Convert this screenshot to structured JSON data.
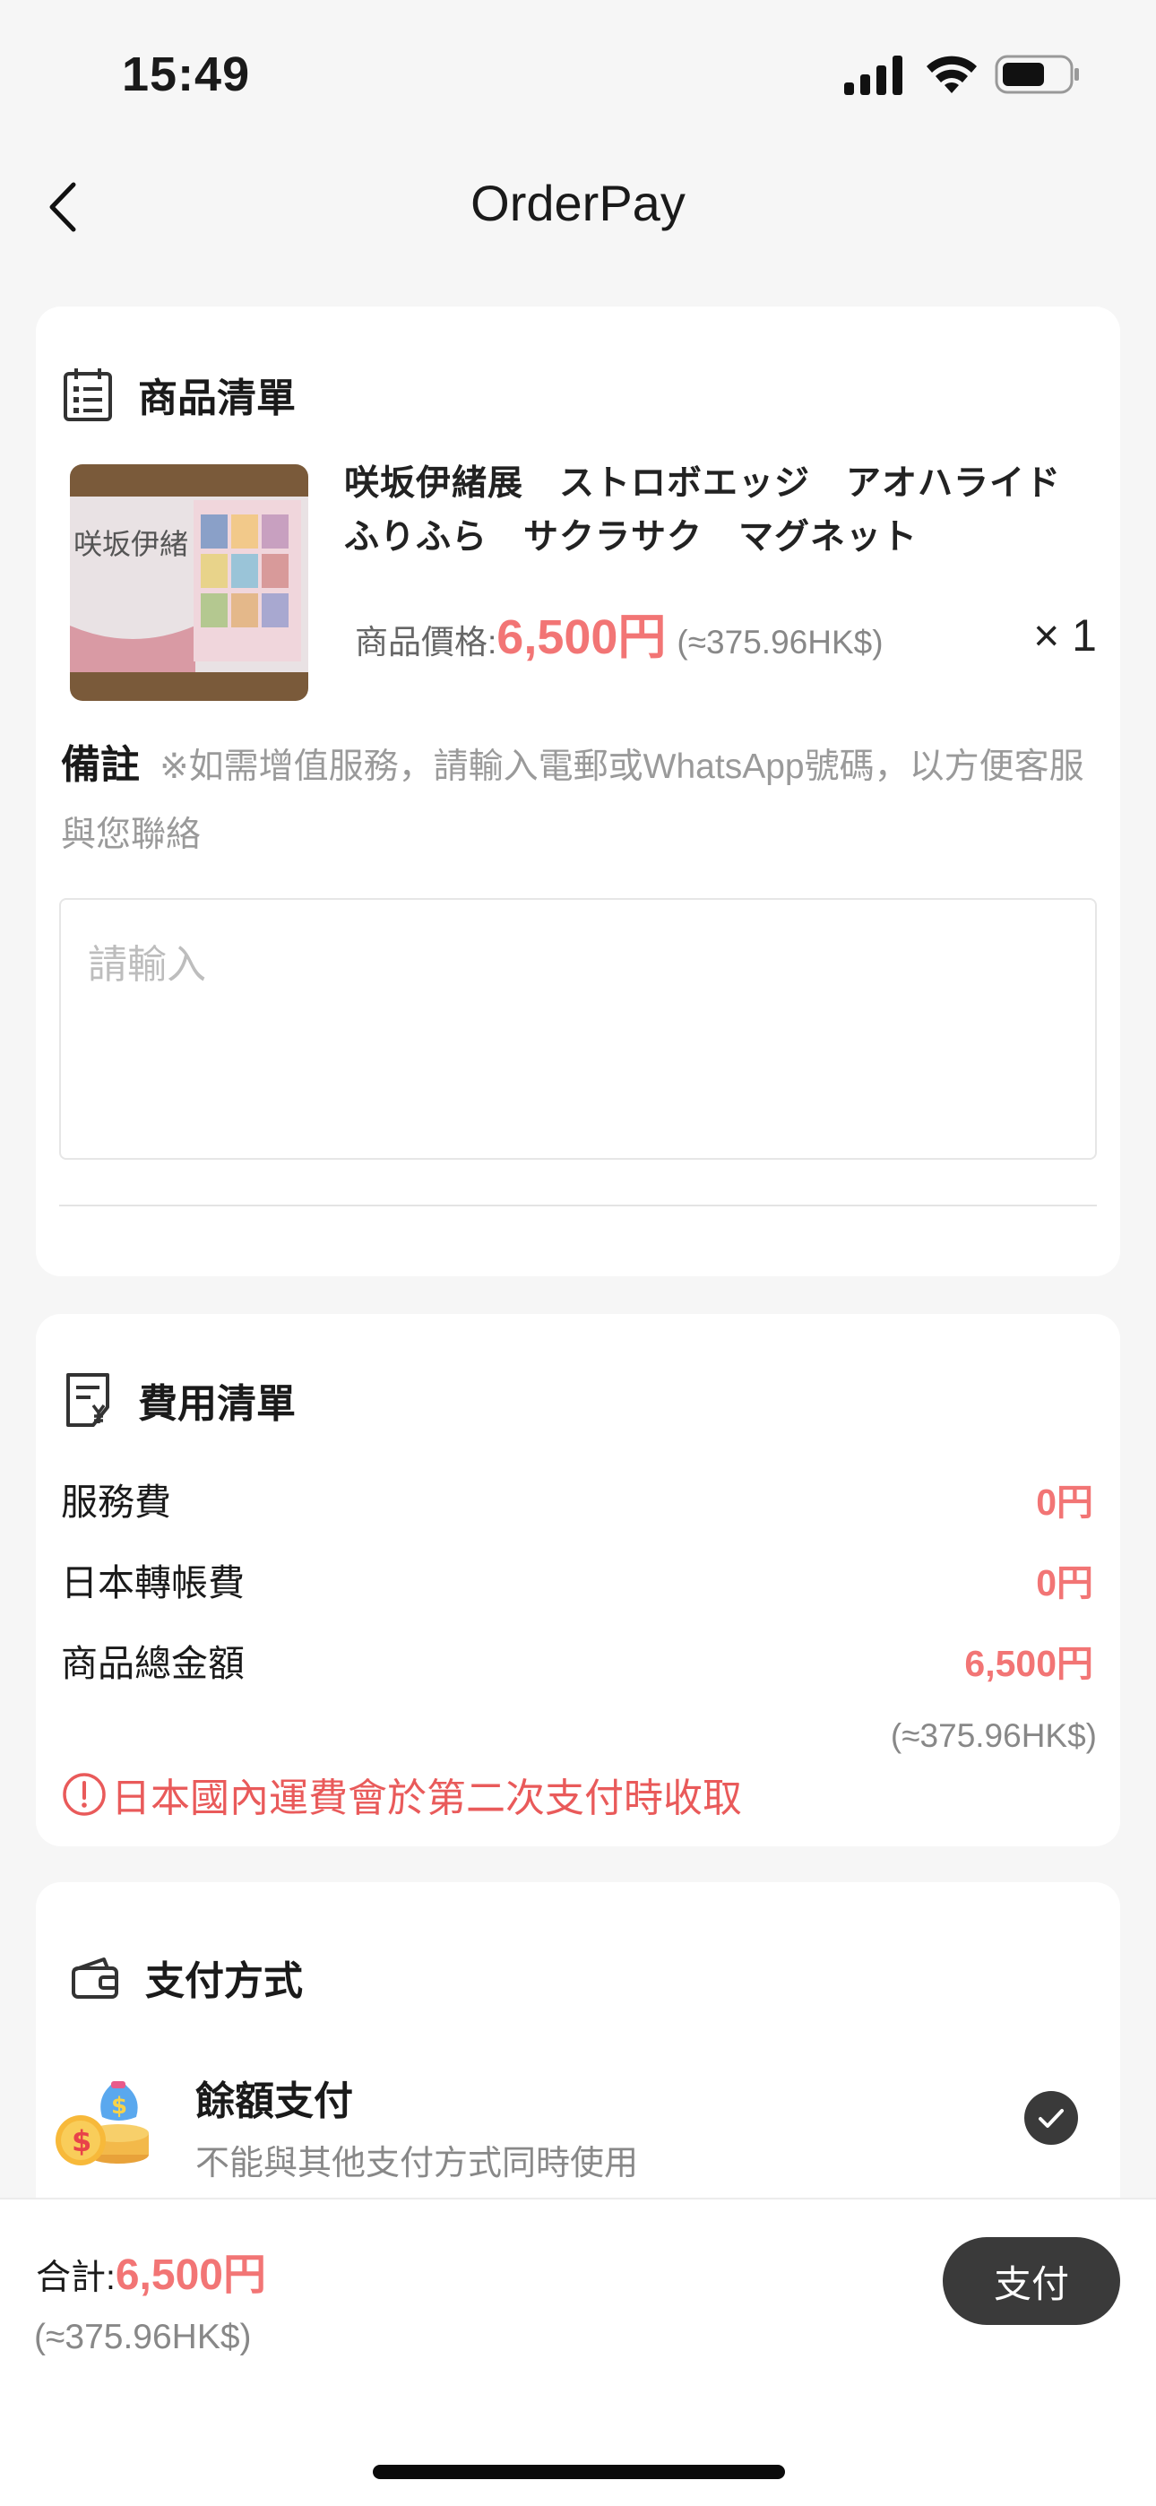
{
  "status_bar": {
    "time": "15:49"
  },
  "nav": {
    "title": "OrderPay"
  },
  "product_list": {
    "title": "商品清單",
    "item": {
      "name": "咲坂伊緒展　ストロボエッジ　アオハライド　ふりふら　サクラサク　マグネット",
      "price_label": "商品價格:",
      "price": "6,500円",
      "price_hkd": "(≈375.96HK$)",
      "quantity": "× 1"
    },
    "remark": {
      "label": "備註",
      "hint": "※如需增值服務，請輸入電郵或WhatsApp號碼，以方便客服與您聯絡",
      "placeholder": "請輸入"
    }
  },
  "fee_list": {
    "title": "費用清單",
    "rows": [
      {
        "label": "服務費",
        "value": "0円"
      },
      {
        "label": "日本轉帳費",
        "value": "0円"
      },
      {
        "label": "商品總金額",
        "value": "6,500円"
      }
    ],
    "total_hkd": "(≈375.96HK$)",
    "notice": "日本國內運費會於第二次支付時收取"
  },
  "payment": {
    "title": "支付方式",
    "method": {
      "name": "餘額支付",
      "desc": "不能與其他支付方式同時使用",
      "selected": true
    }
  },
  "footer": {
    "total_label": "合計:",
    "total": "6,500円",
    "total_hkd": "(≈375.96HK$)",
    "pay_label": "支付"
  },
  "colors": {
    "accent": "#f27575",
    "notice": "#e95a5a",
    "button": "#3a3a3a"
  }
}
